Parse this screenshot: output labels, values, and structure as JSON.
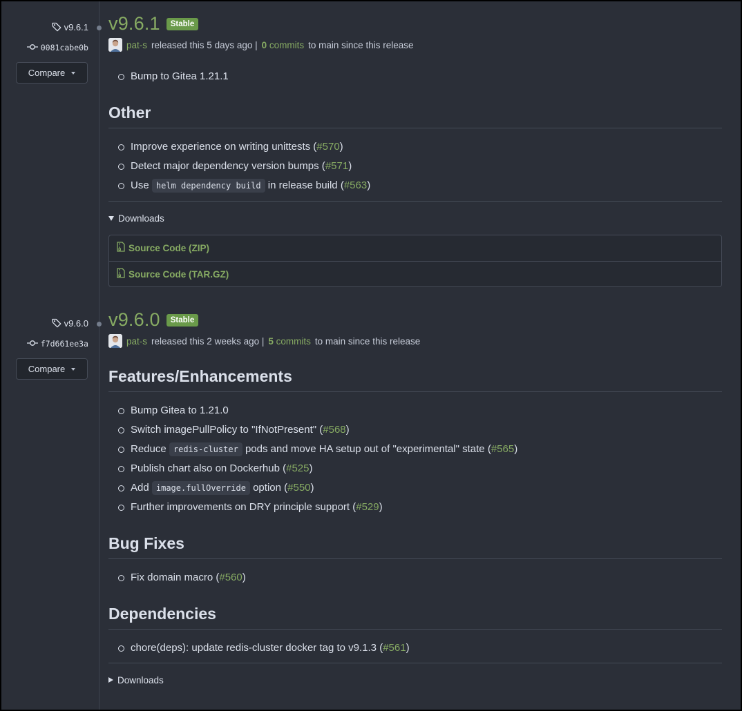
{
  "colors": {
    "background": "#2b2f38",
    "accent": "#87ab63",
    "stable_badge": "#6a9a4a",
    "text": "#dbe0ea",
    "border": "#454b57"
  },
  "releases": [
    {
      "tag": "v9.6.1",
      "commit": "0081cabe0b",
      "compare_label": "Compare",
      "title": "v9.6.1",
      "badge": "Stable",
      "author": "pat-s",
      "released_text": "released this 5 days ago |",
      "commits_count": "0",
      "commits_label": "commits",
      "since_text": "to main since this release",
      "top_items": [
        {
          "text": "Bump to Gitea 1.21.1"
        }
      ],
      "sections": [
        {
          "heading": "Other",
          "items": [
            {
              "pre": "Improve experience on writing unittests (",
              "link": "#570",
              "post": ")"
            },
            {
              "pre": "Detect major dependency version bumps (",
              "link": "#571",
              "post": ")"
            },
            {
              "pre": "Use",
              "code": "helm dependency build",
              "mid": "in release build (",
              "link": "#563",
              "post": ")"
            }
          ]
        }
      ],
      "downloads_label": "Downloads",
      "downloads": [
        "Source Code (ZIP)",
        "Source Code (TAR.GZ)"
      ]
    },
    {
      "tag": "v9.6.0",
      "commit": "f7d661ee3a",
      "compare_label": "Compare",
      "title": "v9.6.0",
      "badge": "Stable",
      "author": "pat-s",
      "released_text": "released this 2 weeks ago |",
      "commits_count": "5",
      "commits_label": "commits",
      "since_text": "to main since this release",
      "sections": [
        {
          "heading": "Features/Enhancements",
          "items": [
            {
              "pre": "Bump Gitea to 1.21.0"
            },
            {
              "pre": "Switch imagePullPolicy to \"IfNotPresent\" (",
              "link": "#568",
              "post": ")"
            },
            {
              "pre": "Reduce",
              "code": "redis-cluster",
              "mid": "pods and move HA setup out of \"experimental\" state (",
              "link": "#565",
              "post": ")"
            },
            {
              "pre": "Publish chart also on Dockerhub (",
              "link": "#525",
              "post": ")"
            },
            {
              "pre": "Add",
              "code": "image.fullOverride",
              "mid": "option (",
              "link": "#550",
              "post": ")"
            },
            {
              "pre": "Further improvements on DRY principle support (",
              "link": "#529",
              "post": ")"
            }
          ]
        },
        {
          "heading": "Bug Fixes",
          "items": [
            {
              "pre": "Fix domain macro (",
              "link": "#560",
              "post": ")"
            }
          ]
        },
        {
          "heading": "Dependencies",
          "items": [
            {
              "pre": "chore(deps): update redis-cluster docker tag to v9.1.3 (",
              "link": "#561",
              "post": ")"
            }
          ]
        }
      ],
      "downloads_label": "Downloads"
    }
  ]
}
